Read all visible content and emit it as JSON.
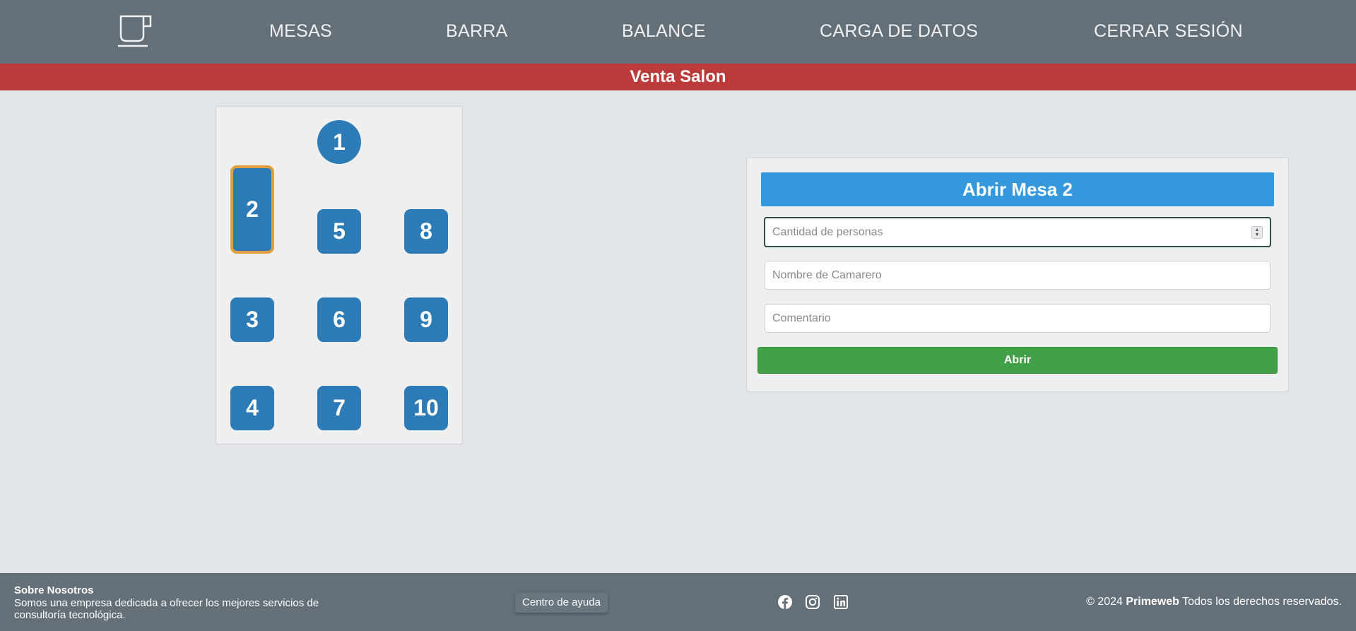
{
  "nav": {
    "logo_icon": "coffee-cup-icon",
    "items": [
      "MESAS",
      "BARRA",
      "BALANCE",
      "CARGA DE DATOS",
      "CERRAR SESIÓN"
    ]
  },
  "banner": {
    "title": "Venta Salon"
  },
  "tables": {
    "selected": "2",
    "items": [
      {
        "label": "1",
        "shape": "round"
      },
      {
        "label": "2",
        "shape": "tall"
      },
      {
        "label": "3",
        "shape": "square"
      },
      {
        "label": "4",
        "shape": "square"
      },
      {
        "label": "5",
        "shape": "square"
      },
      {
        "label": "6",
        "shape": "square"
      },
      {
        "label": "7",
        "shape": "square"
      },
      {
        "label": "8",
        "shape": "square"
      },
      {
        "label": "9",
        "shape": "square"
      },
      {
        "label": "10",
        "shape": "square"
      }
    ]
  },
  "form": {
    "title": "Abrir Mesa 2",
    "personas_placeholder": "Cantidad de personas",
    "camarero_placeholder": "Nombre de Camarero",
    "comentario_placeholder": "Comentario",
    "submit_label": "Abrir"
  },
  "footer": {
    "about_title": "Sobre Nosotros",
    "about_text": "Somos una empresa dedicada a ofrecer los mejores servicios de consultoría tecnológica.",
    "help_label": "Centro de ayuda",
    "social_icons": [
      "facebook-icon",
      "instagram-icon",
      "linkedin-icon"
    ],
    "copyright_prefix": "© 2024",
    "copyright_brand": "Primeweb",
    "copyright_suffix": "Todos los derechos reservados."
  },
  "colors": {
    "nav_bg": "#656f78",
    "banner_bg": "#bd3a3a",
    "table_blue": "#2c7bb6",
    "selected_border": "#e0a040",
    "form_title_bg": "#3698dc",
    "submit_bg": "#42a047",
    "page_bg": "#e1e5ea"
  }
}
